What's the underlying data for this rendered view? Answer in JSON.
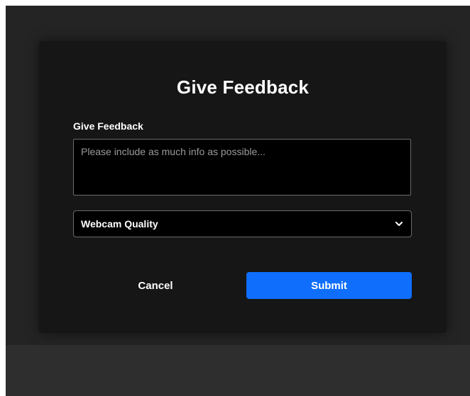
{
  "modal": {
    "title": "Give Feedback",
    "feedback_label": "Give Feedback",
    "feedback_placeholder": "Please include as much info as possible...",
    "feedback_value": "",
    "category_selected": "Webcam Quality",
    "cancel_label": "Cancel",
    "submit_label": "Submit"
  },
  "icons": {
    "dropdown": "chevron-down-icon"
  },
  "colors": {
    "background": "#242424",
    "modal_background": "#161616",
    "input_background": "#000000",
    "accent": "#0f6efc",
    "text": "#ffffff",
    "placeholder": "#9a9a9a"
  }
}
